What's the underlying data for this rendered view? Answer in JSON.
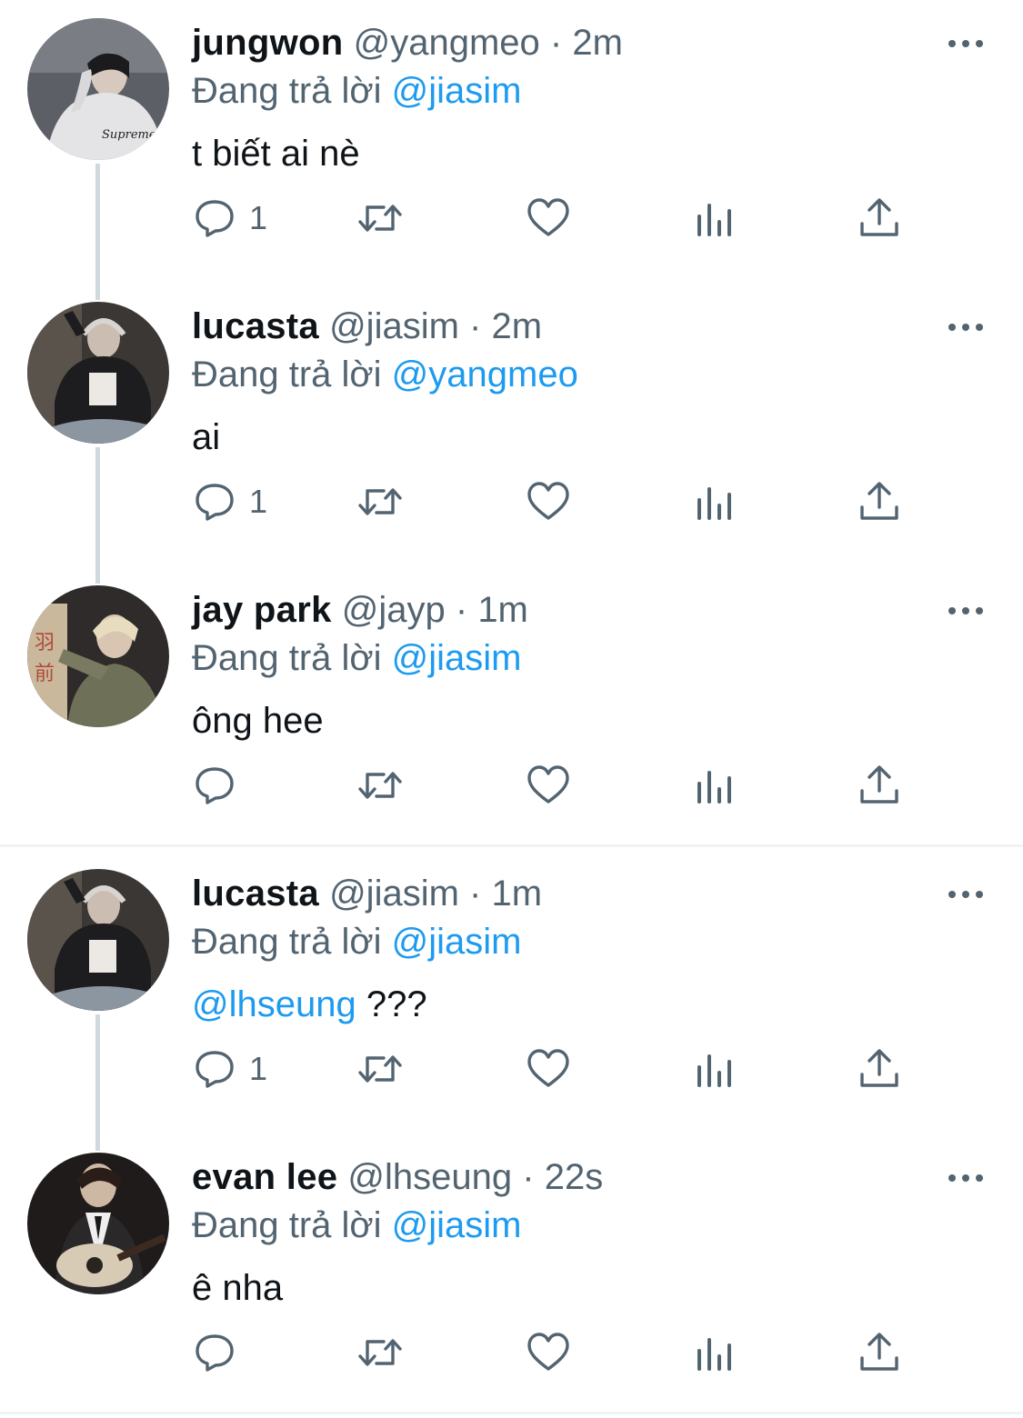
{
  "tweets": [
    {
      "name": "jungwon",
      "handle": "@yangmeo",
      "dot": "·",
      "time": "2m",
      "reply_prefix": "Đang trả lời",
      "reply_to": "@jiasim",
      "text_mention": "",
      "text": "t biết ai nè",
      "reply_count": "1",
      "avatar": "person-in-white-hoodie-avatar"
    },
    {
      "name": "lucasta",
      "handle": "@jiasim",
      "dot": "·",
      "time": "2m",
      "reply_prefix": "Đang trả lời",
      "reply_to": "@yangmeo",
      "text_mention": "",
      "text": "ai",
      "reply_count": "1",
      "avatar": "person-with-headphones-avatar"
    },
    {
      "name": "jay park",
      "handle": "@jayp",
      "dot": "·",
      "time": "1m",
      "reply_prefix": "Đang trả lời",
      "reply_to": "@jiasim",
      "text_mention": "",
      "text": "ông hee",
      "reply_count": "",
      "avatar": "blond-person-avatar"
    },
    {
      "name": "lucasta",
      "handle": "@jiasim",
      "dot": "·",
      "time": "1m",
      "reply_prefix": "Đang trả lời",
      "reply_to": "@jiasim",
      "text_mention": "@lhseung",
      "text": "???",
      "reply_count": "1",
      "avatar": "person-with-headphones-avatar"
    },
    {
      "name": "evan lee",
      "handle": "@lhseung",
      "dot": "·",
      "time": "22s",
      "reply_prefix": "Đang trả lời",
      "reply_to": "@jiasim",
      "text_mention": "",
      "text": "ê nha",
      "reply_count": "",
      "avatar": "person-with-guitar-avatar"
    }
  ],
  "colors": {
    "accent": "#1d9bf0",
    "secondary_text": "#536471",
    "thread_line": "#cfd9de",
    "divider": "#eff3f4"
  },
  "icons": {
    "reply": "speech-bubble-icon",
    "retweet": "retweet-arrows-icon",
    "like": "heart-icon",
    "views": "bar-chart-icon",
    "share": "share-upload-icon",
    "more": "more-dots-icon"
  }
}
